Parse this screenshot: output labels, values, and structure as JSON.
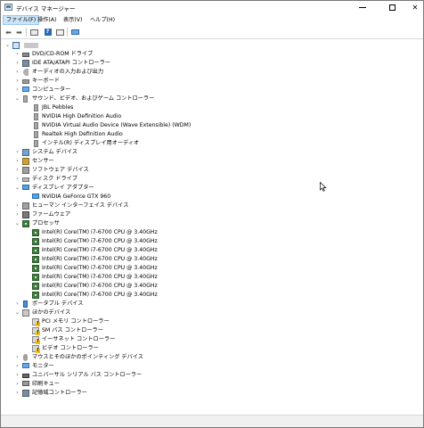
{
  "window": {
    "title": "デバイス マネージャー"
  },
  "menu": [
    {
      "label": "ファイル(F)",
      "active": true
    },
    {
      "label": "操作(A)"
    },
    {
      "label": "表示(V)"
    },
    {
      "label": "ヘルプ(H)"
    }
  ],
  "toolbar": {
    "buttons": [
      "back-arrow-icon",
      "forward-arrow-icon",
      "properties-icon",
      "help-icon",
      "update-driver-icon",
      "monitor-icon"
    ]
  },
  "tree": {
    "root": {
      "label": ""
    },
    "nodes": [
      {
        "label": "DVD/CD-ROM ドライブ",
        "icon": "dvd-drive-icon",
        "expanded": false
      },
      {
        "label": "IDE ATA/ATAPI コントローラー",
        "icon": "ide-controller-icon",
        "expanded": false
      },
      {
        "label": "オーディオの入力および出力",
        "icon": "audio-io-icon",
        "expanded": false
      },
      {
        "label": "キーボード",
        "icon": "keyboard-icon",
        "expanded": false
      },
      {
        "label": "コンピューター",
        "icon": "computer-icon",
        "expanded": false
      },
      {
        "label": "サウンド、ビデオ、およびゲーム コントローラー",
        "icon": "sound-controller-icon",
        "expanded": true,
        "children": [
          "JBL Pebbles",
          "NVIDIA High Definition Audio",
          "NVIDIA Virtual Audio Device (Wave Extensible) (WDM)",
          "Realtek High Definition Audio",
          "インテル(R) ディスプレイ用オーディオ"
        ]
      },
      {
        "label": "システム デバイス",
        "icon": "system-device-icon",
        "expanded": false
      },
      {
        "label": "センサー",
        "icon": "sensor-icon",
        "expanded": false
      },
      {
        "label": "ソフトウェア デバイス",
        "icon": "software-device-icon",
        "expanded": false
      },
      {
        "label": "ディスク ドライブ",
        "icon": "disk-drive-icon",
        "expanded": false
      },
      {
        "label": "ディスプレイ アダプター",
        "icon": "display-adapter-icon",
        "expanded": true,
        "children": [
          "NVIDIA GeForce GTX 960"
        ]
      },
      {
        "label": "ヒューマン インターフェイス デバイス",
        "icon": "hid-icon",
        "expanded": false
      },
      {
        "label": "ファームウェア",
        "icon": "firmware-icon",
        "expanded": false
      },
      {
        "label": "プロセッサ",
        "icon": "processor-icon",
        "expanded": true,
        "children": [
          "Intel(R) Core(TM) i7-6700 CPU @ 3.40GHz",
          "Intel(R) Core(TM) i7-6700 CPU @ 3.40GHz",
          "Intel(R) Core(TM) i7-6700 CPU @ 3.40GHz",
          "Intel(R) Core(TM) i7-6700 CPU @ 3.40GHz",
          "Intel(R) Core(TM) i7-6700 CPU @ 3.40GHz",
          "Intel(R) Core(TM) i7-6700 CPU @ 3.40GHz",
          "Intel(R) Core(TM) i7-6700 CPU @ 3.40GHz",
          "Intel(R) Core(TM) i7-6700 CPU @ 3.40GHz"
        ]
      },
      {
        "label": "ポータブル デバイス",
        "icon": "portable-device-icon",
        "expanded": false
      },
      {
        "label": "ほかのデバイス",
        "icon": "other-device-icon",
        "expanded": true,
        "children": [
          "PCI メモリ コントローラー",
          "SM バス コントローラー",
          "イーサネット コントローラー",
          "ビデオ コントローラー"
        ]
      },
      {
        "label": "マウスとそのほかのポインティング デバイス",
        "icon": "mouse-icon",
        "expanded": false
      },
      {
        "label": "モニター",
        "icon": "monitor-icon",
        "expanded": false
      },
      {
        "label": "ユニバーサル シリアル バス コントローラー",
        "icon": "usb-controller-icon",
        "expanded": false
      },
      {
        "label": "印刷キュー",
        "icon": "print-queue-icon",
        "expanded": false
      },
      {
        "label": "記憶域コントローラー",
        "icon": "storage-controller-icon",
        "expanded": false
      }
    ]
  }
}
